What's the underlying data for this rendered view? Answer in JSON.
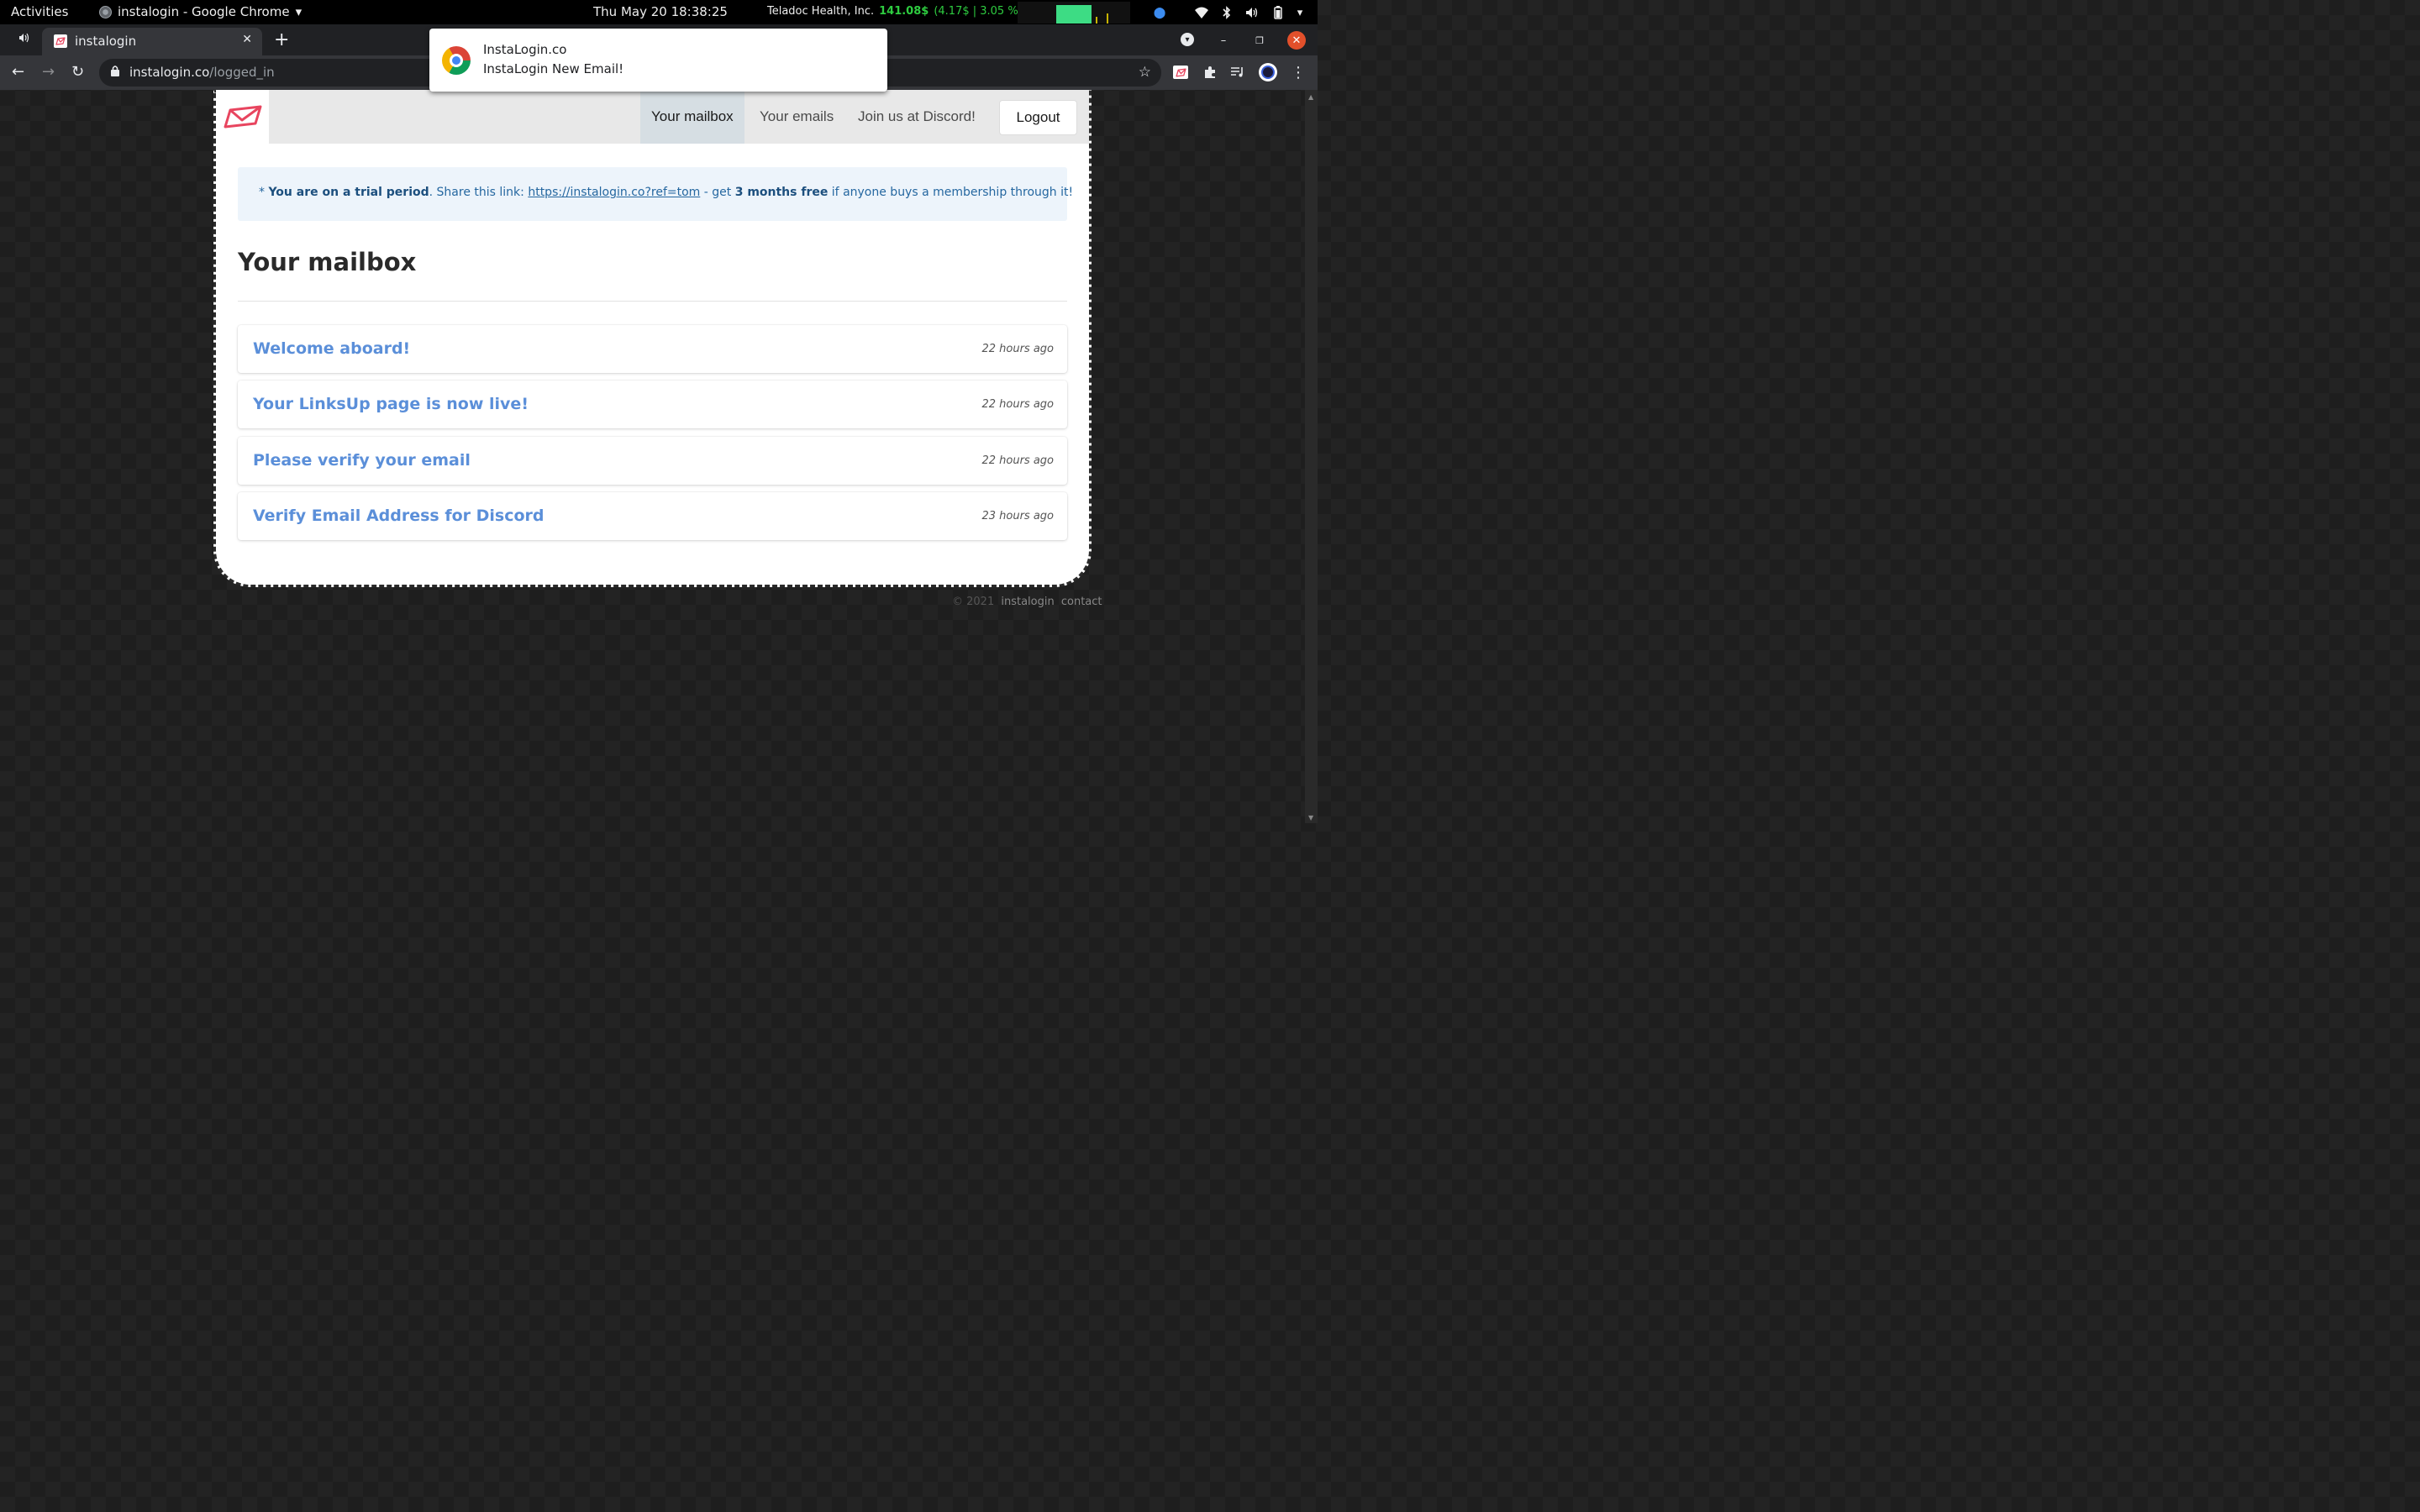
{
  "os_bar": {
    "activities": "Activities",
    "app_title": "instalogin - Google Chrome",
    "clock": "Thu May 20  18:38:25",
    "stock_name": "Teladoc Health, Inc.",
    "stock_price": "141.08$",
    "stock_change": "(4.17$ | 3.05 %)"
  },
  "browser": {
    "tab_title": "instalogin",
    "url_host": "instalogin.co",
    "url_path": "/logged_in"
  },
  "notification": {
    "title": "InstaLogin.co",
    "body": "InstaLogin  New Email!"
  },
  "site": {
    "nav": {
      "mailbox": "Your mailbox",
      "emails": "Your emails",
      "discord": "Join us at Discord!",
      "logout": "Logout"
    },
    "banner": {
      "prefix": "* ",
      "trial_bold": "You are on a trial period",
      "mid": ". Share this link: ",
      "link": "https://instalogin.co?ref=tom",
      "dash": " - get ",
      "free_bold": "3 months free",
      "suffix": " if anyone buys a membership through it!"
    },
    "page_title": "Your mailbox",
    "emails": [
      {
        "subject": "Welcome aboard!",
        "time": "22 hours ago"
      },
      {
        "subject": "Your LinksUp page is now live!",
        "time": "22 hours ago"
      },
      {
        "subject": "Please verify your email",
        "time": "22 hours ago"
      },
      {
        "subject": "Verify Email Address for Discord",
        "time": "23 hours ago"
      }
    ],
    "footer": {
      "copyright": "© 2021",
      "brand": "instalogin",
      "contact": "contact"
    }
  },
  "colors": {
    "link_blue": "#5b8fd9",
    "logo_pink": "#e8455f",
    "stock_green": "#2ecc40"
  }
}
